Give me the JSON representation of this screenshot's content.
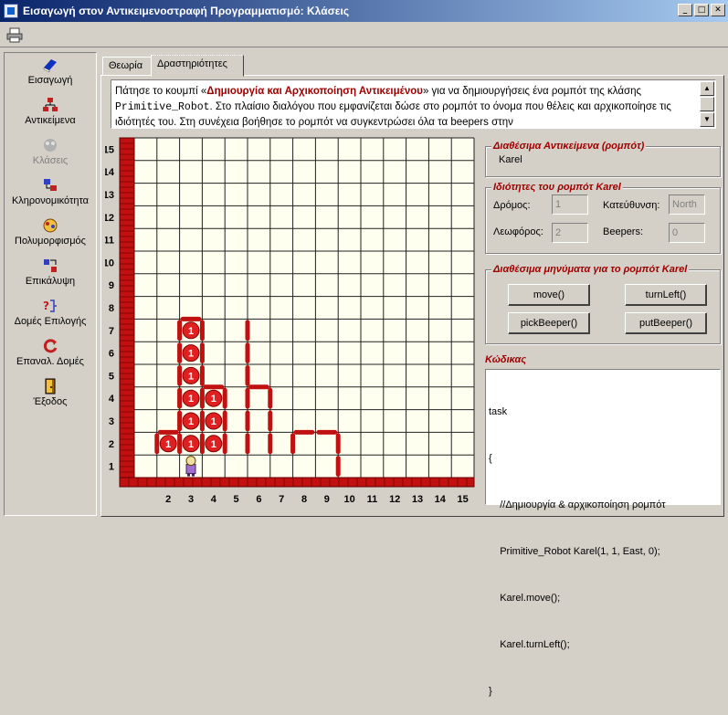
{
  "window": {
    "title": "Εισαγωγή στον Αντικειμενοστραφή Προγραμματισμό: Κλάσεις"
  },
  "sidebar": {
    "items": [
      {
        "label": "Εισαγωγή",
        "icon": "book-icon"
      },
      {
        "label": "Αντικείμενα",
        "icon": "objects-icon"
      },
      {
        "label": "Κλάσεις",
        "icon": "class-icon",
        "disabled": true
      },
      {
        "label": "Κληρονομικότητα",
        "icon": "inheritance-icon"
      },
      {
        "label": "Πολυμορφισμός",
        "icon": "polymorphism-icon"
      },
      {
        "label": "Επικάλυψη",
        "icon": "override-icon"
      },
      {
        "label": "Δομές Επιλογής",
        "icon": "selection-icon"
      },
      {
        "label": "Επαναλ. Δομές",
        "icon": "loop-icon"
      },
      {
        "label": "Έξοδος",
        "icon": "exit-door-icon"
      }
    ]
  },
  "tabs": [
    {
      "label": "Θεωρία"
    },
    {
      "label": "Δραστηριότητες",
      "active": true
    }
  ],
  "instructions": {
    "p1": "Πάτησε το κουμπί «",
    "bold": "Δημιουργία και Αρχικοποίηση Αντικειμένου",
    "p2": "» για να δημιουργήσεις ένα ρομπότ της κλάσης ",
    "mono": "Primitive_Robot",
    "p3": ". Στο πλαίσιο διαλόγου που εμφανίζεται δώσε στο ρομπότ το όνομα που θέλεις και αρχικοποίησε τις ιδιότητές του. Στη συνέχεια βοήθησε το ρομπότ να συγκεντρώσει όλα τα beepers στην"
  },
  "world": {
    "streets": 15,
    "avenues": 15,
    "beepers": [
      [
        2,
        2
      ],
      [
        3,
        2
      ],
      [
        4,
        2
      ],
      [
        3,
        3
      ],
      [
        4,
        3
      ],
      [
        3,
        4
      ],
      [
        4,
        4
      ],
      [
        3,
        5
      ],
      [
        3,
        6
      ],
      [
        3,
        7
      ]
    ],
    "beeper_label": "1",
    "walls_h": [
      [
        2,
        2.5
      ],
      [
        3,
        7.5
      ],
      [
        4,
        4.5
      ],
      [
        6,
        4.5
      ],
      [
        8,
        2.5
      ],
      [
        9,
        2.5
      ]
    ],
    "walls_v": [
      [
        1.5,
        2
      ],
      [
        2.5,
        2
      ],
      [
        2.5,
        3
      ],
      [
        2.5,
        4
      ],
      [
        2.5,
        5
      ],
      [
        2.5,
        6
      ],
      [
        2.5,
        7
      ],
      [
        3.5,
        2
      ],
      [
        3.5,
        3
      ],
      [
        3.5,
        4
      ],
      [
        3.5,
        5
      ],
      [
        3.5,
        6
      ],
      [
        3.5,
        7
      ],
      [
        4.5,
        2
      ],
      [
        4.5,
        3
      ],
      [
        4.5,
        4
      ],
      [
        5.5,
        2
      ],
      [
        5.5,
        3
      ],
      [
        5.5,
        4
      ],
      [
        5.5,
        5
      ],
      [
        5.5,
        6
      ],
      [
        5.5,
        7
      ],
      [
        6.5,
        2
      ],
      [
        6.5,
        3
      ],
      [
        6.5,
        4
      ],
      [
        7.5,
        2
      ],
      [
        9.5,
        1
      ],
      [
        9.5,
        2
      ]
    ],
    "robot": {
      "avenue": 3,
      "street": 1
    },
    "colors": {
      "wall": "#c01010",
      "beeper": "#e02020",
      "grid": "#202020",
      "background": "#fffff0"
    }
  },
  "objects": {
    "title": "Διαθέσιμα Αντικείμενα (ρομπότ)",
    "items": [
      "Karel"
    ]
  },
  "props": {
    "title": "Ιδιότητες του ρομπότ Karel",
    "street_label": "Δρόμος:",
    "street_value": "1",
    "avenue_label": "Λεωφόρος:",
    "avenue_value": "2",
    "direction_label": "Κατεύθυνση:",
    "direction_value": "North",
    "beepers_label": "Beepers:",
    "beepers_value": "0"
  },
  "messages": {
    "title": "Διαθέσιμα μηνύματα για το ρομπότ Karel",
    "move": "move()",
    "turnLeft": "turnLeft()",
    "pickBeeper": "pickBeeper()",
    "putBeeper": "putBeeper()"
  },
  "code": {
    "label": "Κώδικας",
    "lines": [
      "task",
      "{",
      "    //Δημιουργία & αρχικοποίηση ρομπότ",
      "    Primitive_Robot Karel(1, 1, East, 0);",
      "    Karel.move();",
      "    Karel.turnLeft();",
      "}"
    ]
  }
}
